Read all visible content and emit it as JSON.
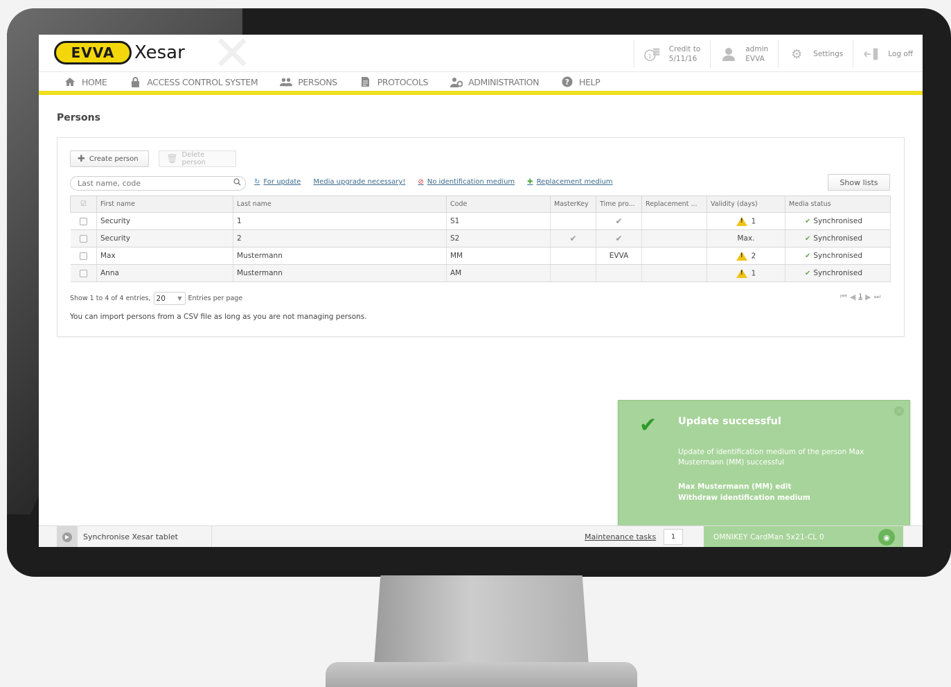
{
  "brand": {
    "logo_badge": "EVVA",
    "product": "Xesar"
  },
  "header": {
    "credit": {
      "line1": "Credit to",
      "line2": "5/11/16"
    },
    "user": {
      "line1": "admin",
      "line2": "EVVA"
    },
    "settings_label": "Settings",
    "logoff_label": "Log off"
  },
  "nav": {
    "items": [
      {
        "label": "HOME",
        "icon": "home-icon"
      },
      {
        "label": "ACCESS CONTROL SYSTEM",
        "icon": "lock-icon"
      },
      {
        "label": "PERSONS",
        "icon": "persons-icon"
      },
      {
        "label": "PROTOCOLS",
        "icon": "document-icon"
      },
      {
        "label": "ADMINISTRATION",
        "icon": "admin-icon"
      },
      {
        "label": "HELP",
        "icon": "help-icon"
      }
    ]
  },
  "page": {
    "title": "Persons"
  },
  "toolbar": {
    "create_label": "Create person",
    "delete_label": "Delete person",
    "search_placeholder": "Last name, code",
    "show_lists_label": "Show lists"
  },
  "filters": [
    {
      "label": "For update",
      "icon": "update-icon"
    },
    {
      "label": "Media upgrade necessary!",
      "icon": ""
    },
    {
      "label": "No identification medium",
      "icon": "no-medium-icon"
    },
    {
      "label": "Replacement medium",
      "icon": "replacement-icon"
    }
  ],
  "table": {
    "columns": [
      "First name",
      "Last name",
      "Code",
      "MasterKey",
      "Time pro...",
      "Replacement ...",
      "Validity (days)",
      "Media status"
    ],
    "rows": [
      {
        "first": "Security",
        "last": "1",
        "code": "S1",
        "masterkey": "",
        "time": "check",
        "replacement": "",
        "validity": "1",
        "validity_warn": true,
        "status": "Synchronised"
      },
      {
        "first": "Security",
        "last": "2",
        "code": "S2",
        "masterkey": "check",
        "time": "check",
        "replacement": "",
        "validity": "Max.",
        "validity_warn": false,
        "status": "Synchronised"
      },
      {
        "first": "Max",
        "last": "Mustermann",
        "code": "MM",
        "masterkey": "",
        "time": "EVVA",
        "replacement": "",
        "validity": "2",
        "validity_warn": true,
        "status": "Synchronised"
      },
      {
        "first": "Anna",
        "last": "Mustermann",
        "code": "AM",
        "masterkey": "",
        "time": "",
        "replacement": "",
        "validity": "1",
        "validity_warn": true,
        "status": "Synchronised"
      }
    ]
  },
  "paging": {
    "info_prefix": "Show 1 to 4 of 4 entries,",
    "page_size": "20",
    "info_suffix": "Entries per page",
    "current_page": "1"
  },
  "import_note": "You can import persons from a CSV file as long as you are not managing persons.",
  "notification": {
    "title": "Update successful",
    "message": "Update of identification medium of the person Max Mustermann (MM) successful",
    "link1": "Max Mustermann (MM) edit",
    "link2": "Withdraw identification medium",
    "color": "#a7d49a"
  },
  "statusbar": {
    "sync_label": "Synchronise Xesar tablet",
    "maintenance_label": "Maintenance tasks",
    "maintenance_count": "1",
    "reader_label": "OMNIKEY CardMan 5x21-CL 0"
  },
  "colors": {
    "accent_yellow": "#f0df1e",
    "success_green": "#a7d49a",
    "link_blue": "#3b6a8e"
  }
}
